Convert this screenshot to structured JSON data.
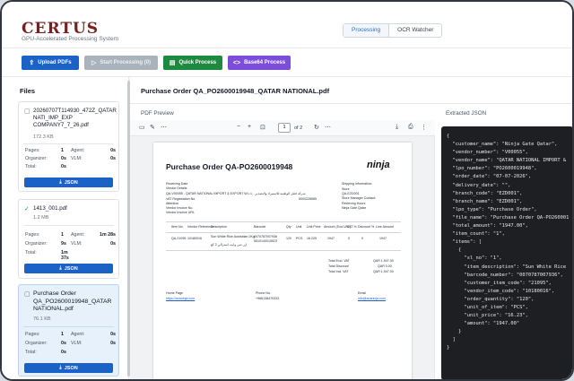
{
  "app": {
    "logo": "CERTUS",
    "subtitle": "GPU-Accelerated Processing System"
  },
  "tabs": [
    {
      "label": "Processing",
      "active": true
    },
    {
      "label": "OCR Watcher",
      "active": false
    }
  ],
  "toolbar": {
    "upload": "Upload PDFs",
    "start": "Start Processing (0)",
    "quick": "Quick Process",
    "base64": "Base64 Process"
  },
  "sidebar": {
    "title": "Files",
    "files": [
      {
        "name": "20260707T114930_472Z_QATAR NATI_IMP_EXP COMPANY7_7_26.pdf",
        "size": "172.3 KB",
        "pages": "1",
        "agent": "0s",
        "organizer": "0s",
        "vlm": "0s",
        "total": "0s",
        "button": "JSON"
      },
      {
        "name": "1413_001.pdf",
        "size": "1.2 MB",
        "pages": "1",
        "agent": "1m 28s",
        "organizer": "9s",
        "vlm": "0s",
        "total": "1m 37s",
        "button": "JSON"
      },
      {
        "name": "Purchase Order QA_PO2600019948_QATAR NATIONAL.pdf",
        "size": "76.1 KB",
        "pages": "1",
        "agent": "0s",
        "organizer": "0s",
        "vlm": "0s",
        "total": "0s",
        "button": "JSON"
      }
    ],
    "labels": {
      "pages": "Pages:",
      "agent": "Agent:",
      "organizer": "Organizer:",
      "vlm": "VLM:",
      "total": "Total:"
    }
  },
  "main": {
    "title": "Purchase Order QA_PO2600019948_QATAR NATIONAL.pdf",
    "pdf_label": "PDF Preview",
    "json_label": "Extracted JSON",
    "page_current": "1",
    "page_total": "of 2"
  },
  "pdf": {
    "title": "Purchase Order QA-PO2600019948",
    "brand": "ninja",
    "left_fields": [
      "Receiving Date",
      "Vendor Details",
      "QA-V00055 - QATAR NATIONAL IMPORT & EXPORT W.L.L - شركة قطر الوطنية للاستيراد والتصدير",
      "VAT Registration No.",
      "Attention",
      "Vendor Invoice No.",
      "Vendor Invoice URL"
    ],
    "vat_value": "5000228585",
    "right_fields": [
      "Shipping Information:",
      "Store",
      "QA-EZD001",
      "Store Manager Contact:",
      "Receiving Hours",
      "Ninja Gate Qatar"
    ],
    "headers": [
      "Item No.",
      "Vendor Reference",
      "Description",
      "Barcode",
      "Qty",
      "Unit",
      "Unit Price",
      "Amount (Excl.VAT)",
      "VAT %",
      "Discount %",
      "Line Amount"
    ],
    "row": [
      "QA-21095",
      "10180016",
      "Sun White Rice Australian 2Kg",
      "0070787007936",
      "120",
      "PCS",
      "16.225",
      "1947",
      "0",
      "0",
      "1947"
    ],
    "desc2": "5510140015523",
    "desc_ar": "ارز صن وايت استرالي 2 كغ",
    "totals": [
      {
        "label": "Total Excl. VAT",
        "value": "QAR 1,947.00"
      },
      {
        "label": "Total Discount",
        "value": "QAR 0.00"
      },
      {
        "label": "Total Incl. VAT",
        "value": "QAR 1,947.00"
      }
    ],
    "footer": [
      {
        "label": "Home Page",
        "value": "https://ananinja.com"
      },
      {
        "label": "Phone No.",
        "value": "+966138470333"
      },
      {
        "label": "Email",
        "value": "info@ananinja.com"
      }
    ]
  },
  "json_text": "{\n  \"customer_name\": \"Ninja Gate Qatar\",\n  \"vendor_number\": \"V00055\",\n  \"vendor_name\": \"QATAR NATIONAL IMPORT &\n  \"lpo_number\": \"PO2600019948\",\n  \"order_date\": \"07-07-2026\",\n  \"delivery_date\": \"\",\n  \"branch_code\": \"EZD001\",\n  \"branch_name\": \"EZD001\",\n  \"lpo_type\": \"Purchase Order\",\n  \"file_name\": \"Purchase Order QA-PO260001\n  \"total_amount\": \"1947.00\",\n  \"item_count\": \"1\",\n  \"items\": [\n    {\n      \"sl_no\": \"1\",\n      \"item_description\": \"Sun White Rice\n      \"barcode_number\": \"0070787007936\",\n      \"customer_item_code\": \"21095\",\n      \"vendor_item_code\": \"10180016\",\n      \"order_quantity\": \"120\",\n      \"unit_of_item\": \"PCS\",\n      \"unit_price\": \"16.23\",\n      \"amount\": \"1947.00\"\n    }\n  ]\n}"
}
